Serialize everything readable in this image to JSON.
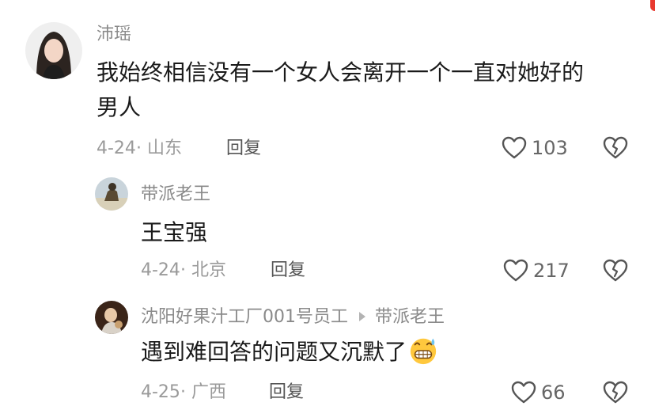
{
  "comments": [
    {
      "username": "沛瑶",
      "content_lines": [
        "我始终相信没有一个女人会离开一个一直对她好的",
        "男人"
      ],
      "date": "4-24",
      "location": "山东",
      "reply_label": "回复",
      "likes": "103"
    },
    {
      "username": "带派老王",
      "content_lines": [
        "王宝强"
      ],
      "date": "4-24",
      "location": "北京",
      "reply_label": "回复",
      "likes": "217"
    },
    {
      "username": "沈阳好果汁工厂001号员工",
      "reply_to": "带派老王",
      "content_lines": [
        "遇到难回答的问题又沉默了"
      ],
      "emoji": "grinning-sweat-emoji",
      "date": "4-25",
      "location": "广西",
      "reply_label": "回复",
      "likes": "66"
    }
  ],
  "meta_separator": "· ",
  "icons": {
    "like": "heart-outline-icon",
    "dislike": "broken-heart-icon"
  },
  "colors": {
    "username": "#8a8a8a",
    "meta": "#9a9a9a",
    "icon": "#555555"
  }
}
